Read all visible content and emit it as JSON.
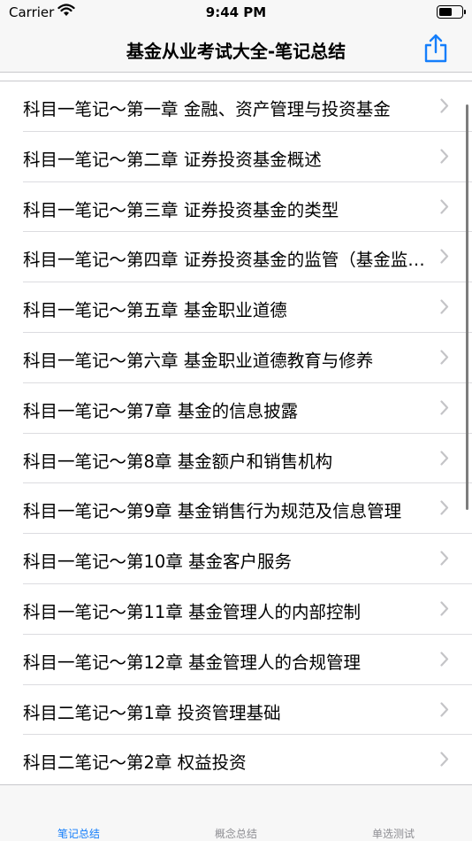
{
  "status": {
    "carrier": "Carrier",
    "time": "9:44 PM"
  },
  "nav": {
    "title": "基金从业考试大全-笔记总结",
    "share_icon": "share-icon"
  },
  "list": [
    {
      "label": "科目一笔记～第一章 金融、资产管理与投资基金"
    },
    {
      "label": "科目一笔记～第二章 证券投资基金概述"
    },
    {
      "label": "科目一笔记～第三章 证券投资基金的类型"
    },
    {
      "label": "科目一笔记～第四章 证券投资基金的监管（基金监管）"
    },
    {
      "label": "科目一笔记～第五章  基金职业道德"
    },
    {
      "label": "科目一笔记～第六章 基金职业道德教育与修养"
    },
    {
      "label": "科目一笔记～第7章 基金的信息披露"
    },
    {
      "label": "科目一笔记～第8章 基金额户和销售机构"
    },
    {
      "label": "科目一笔记～第9章 基金销售行为规范及信息管理"
    },
    {
      "label": "科目一笔记～第10章 基金客户服务"
    },
    {
      "label": "科目一笔记～第11章 基金管理人的内部控制"
    },
    {
      "label": "科目一笔记～第12章 基金管理人的合规管理"
    },
    {
      "label": "科目二笔记～第1章 投资管理基础"
    },
    {
      "label": "科目二笔记～第2章 权益投资"
    }
  ],
  "tabs": [
    {
      "label": "笔记总结",
      "active": true
    },
    {
      "label": "概念总结",
      "active": false
    },
    {
      "label": "单选测试",
      "active": false
    }
  ],
  "colors": {
    "accent": "#147efb",
    "inactive": "#8e8e93",
    "chevron": "#c4c4c7"
  }
}
